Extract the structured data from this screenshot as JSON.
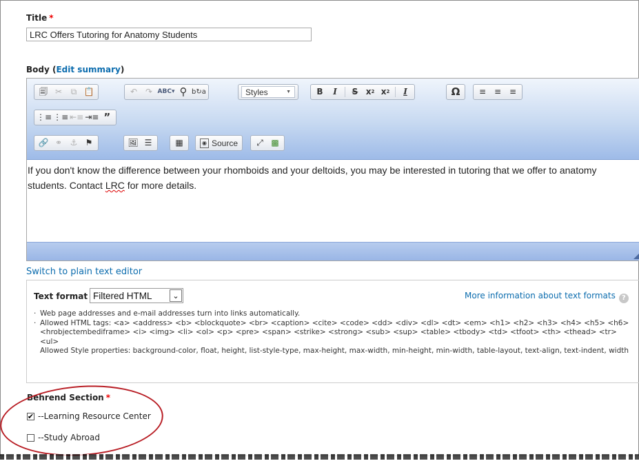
{
  "title_field": {
    "label": "Title",
    "required_marker": "*",
    "value": "LRC Offers Tutoring for Anatomy Students"
  },
  "body_field": {
    "label": "Body",
    "edit_summary_paren_open": "(",
    "edit_summary": "Edit summary",
    "edit_summary_paren_close": ")"
  },
  "toolbar": {
    "styles_label": "Styles",
    "source_label": "Source",
    "row1": [
      "paste-icon",
      "cut-icon",
      "copy-icon",
      "paste-text-icon",
      "undo-icon",
      "redo-icon",
      "spellcheck-icon",
      "find-icon",
      "replace-icon",
      "bold",
      "italic",
      "strikethrough",
      "subscript",
      "superscript",
      "remove-format",
      "special-char",
      "align-left",
      "align-center",
      "align-right"
    ],
    "row2": [
      "bulleted-list",
      "numbered-list",
      "outdent",
      "indent",
      "blockquote"
    ],
    "row3": [
      "link",
      "unlink",
      "anchor",
      "flag",
      "image",
      "horizontal-rule",
      "table",
      "source",
      "maximize",
      "show-blocks"
    ]
  },
  "editor_content": {
    "line1": "If you don't know the difference between your rhomboids and your deltoids, you may be interested in tutoring that we offer to anatomy",
    "line2_start": "students.  Contact ",
    "line2_misspelled": "LRC",
    "line2_end": " for more details."
  },
  "switch_link": "Switch to plain text editor",
  "text_format": {
    "label": "Text format",
    "selected": "Filtered HTML",
    "more_info": "More information about text formats",
    "tips": [
      "Web page addresses and e-mail addresses turn into links automatically.",
      "Allowed HTML tags: <a> <address> <b> <blockquote> <br> <caption> <cite> <code> <dd> <div> <dl> <dt> <em> <h1> <h2> <h3> <h4> <h5> <h6> <hrobjectembediframe> <i> <img> <li> <ol> <p> <pre> <span> <strike> <strong> <sub> <sup> <table> <tbody> <td> <tfoot> <th> <thead> <tr> <ul>"
    ],
    "style_props": "Allowed Style properties: background-color, float, height, list-style-type, max-height, max-width, min-height, min-width, table-layout, text-align, text-indent, width"
  },
  "section_field": {
    "label": "Behrend Section",
    "required_marker": "*",
    "options": [
      {
        "label": "--Learning Resource Center",
        "checked": true
      },
      {
        "label": "--Study Abroad",
        "checked": false
      }
    ]
  },
  "colors": {
    "link": "#0b6cae",
    "required": "#e00000",
    "annotation": "#b81d24",
    "toolbar_bottom": "#9ebbe8"
  }
}
